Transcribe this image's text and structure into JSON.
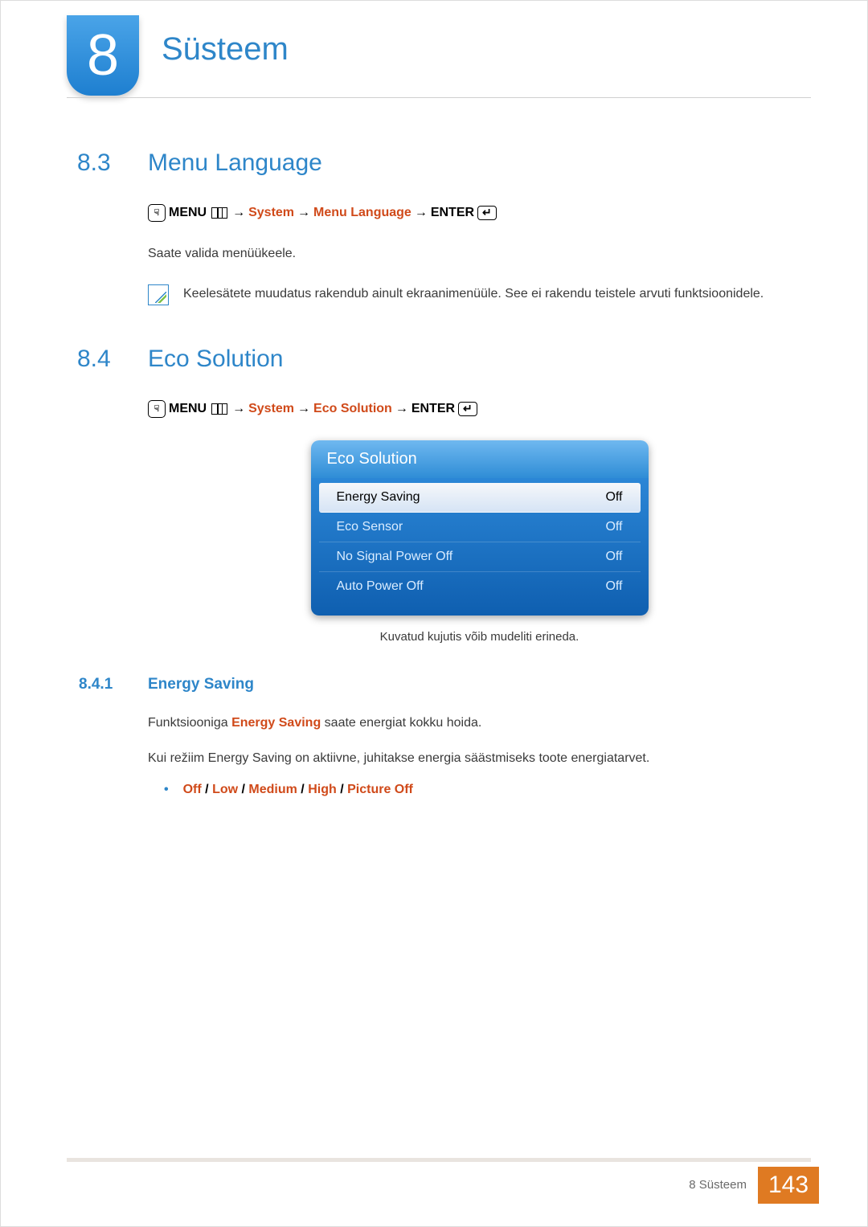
{
  "chapter": {
    "number": "8",
    "title": "Süsteem"
  },
  "section_8_3": {
    "num": "8.3",
    "title": "Menu Language",
    "path": {
      "menu": "MENU",
      "arrow": "→",
      "p1": "System",
      "p2": "Menu Language",
      "enter": "ENTER"
    },
    "body": "Saate valida menüükeele.",
    "note": "Keelesätete muudatus rakendub ainult ekraanimenüüle. See ei rakendu teistele arvuti funktsioonidele."
  },
  "section_8_4": {
    "num": "8.4",
    "title": "Eco Solution",
    "path": {
      "menu": "MENU",
      "arrow": "→",
      "p1": "System",
      "p2": "Eco Solution",
      "enter": "ENTER"
    },
    "osd": {
      "header": "Eco Solution",
      "rows": [
        {
          "label": "Energy Saving",
          "value": "Off",
          "selected": true
        },
        {
          "label": "Eco Sensor",
          "value": "Off",
          "selected": false
        },
        {
          "label": "No Signal Power Off",
          "value": "Off",
          "selected": false
        },
        {
          "label": "Auto Power Off",
          "value": "Off",
          "selected": false
        }
      ],
      "caption": "Kuvatud kujutis võib mudeliti erineda."
    },
    "sub_8_4_1": {
      "num": "8.4.1",
      "title": "Energy Saving",
      "para1_pre": "Funktsiooniga ",
      "para1_kw": "Energy Saving",
      "para1_post": " saate energiat kokku hoida.",
      "para2": "Kui režiim Energy Saving on aktiivne, juhitakse energia säästmiseks toote energiatarvet.",
      "options": [
        "Off",
        "Low",
        "Medium",
        "High",
        "Picture Off"
      ],
      "sep": " / "
    }
  },
  "footer": {
    "label": "8 Süsteem",
    "page": "143"
  }
}
